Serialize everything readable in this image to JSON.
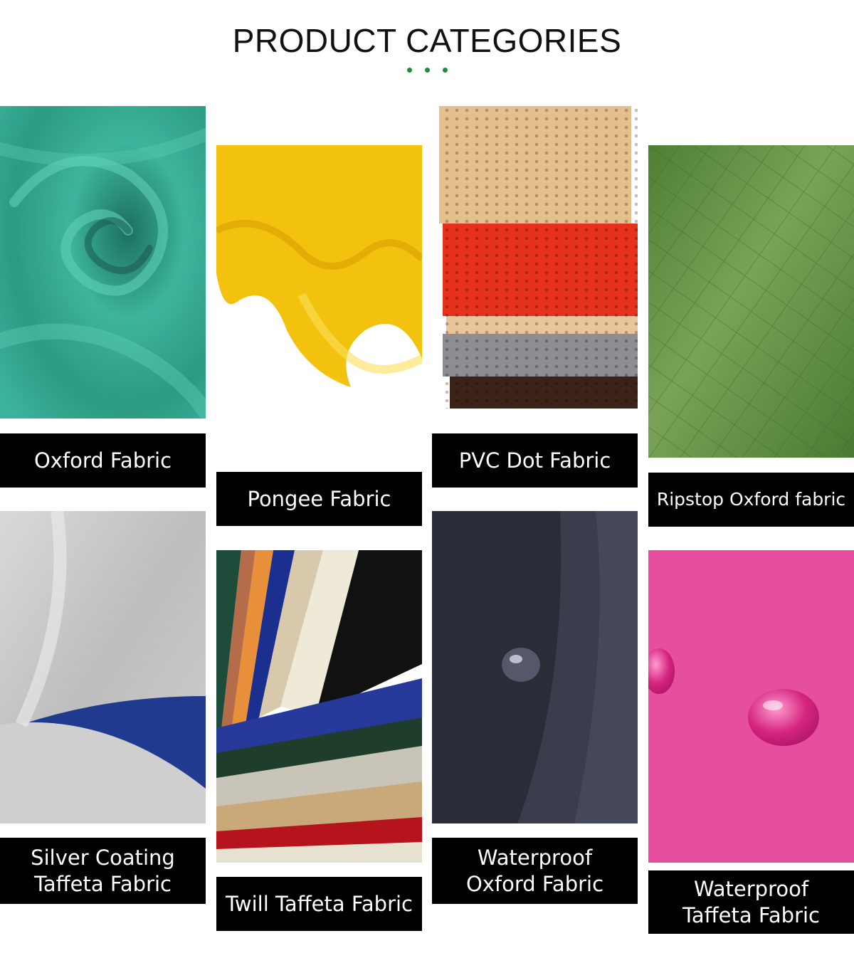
{
  "header": {
    "title": "PRODUCT CATEGORIES"
  },
  "products": [
    {
      "label": "Oxford Fabric",
      "image": "teal-swirl-fabric",
      "color": "#2fa38c"
    },
    {
      "label": "Pongee Fabric",
      "image": "yellow-wave-fabric",
      "color": "#f5c518"
    },
    {
      "label": "PVC Dot Fabric",
      "image": "stacked-dot-fabric",
      "color": "#e23a22"
    },
    {
      "label": "Ripstop Oxford fabric",
      "image": "green-ripstop-fabric",
      "color": "#5a8a3c"
    },
    {
      "label": "Silver Coating\nTaffeta Fabric",
      "image": "silver-blue-fabric",
      "color": "#bfbfbf"
    },
    {
      "label": "Twill Taffeta Fabric",
      "image": "twill-swatch-fan",
      "color": "#2a3fa0"
    },
    {
      "label": "Waterproof\nOxford Fabric",
      "image": "navy-waterdrop-fabric",
      "color": "#2b2d3a"
    },
    {
      "label": "Waterproof\nTaffeta Fabric",
      "image": "pink-waterdrop-fabric",
      "color": "#e64a9a"
    }
  ]
}
